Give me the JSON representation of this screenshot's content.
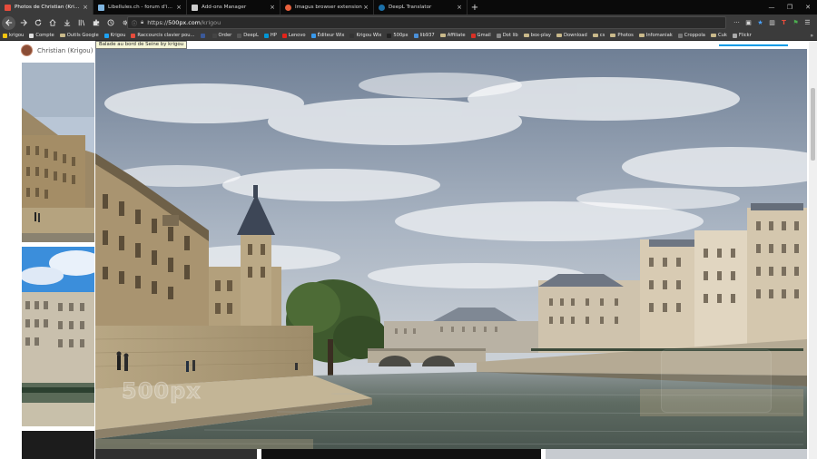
{
  "tabs": [
    {
      "title": "Photos de Christian (Krigou) S",
      "color": "#e74c3c",
      "active": true
    },
    {
      "title": "Libellules.ch - forum d'informa",
      "color": "#7fb5e0",
      "active": false
    },
    {
      "title": "Add-ons Manager",
      "color": "#cccccc",
      "active": false
    },
    {
      "title": "Imagus browser extension",
      "color": "#e8603c",
      "active": false
    },
    {
      "title": "DeepL Translator",
      "color": "#1b6fa8",
      "active": false
    }
  ],
  "urlbar": {
    "prefix": "https://",
    "host": "500px.com",
    "path": "/krigou"
  },
  "bookmarks": [
    {
      "label": "krigou",
      "color": "#f1c40f",
      "folder": false
    },
    {
      "label": "Compte",
      "color": "#e0e0e0",
      "folder": false
    },
    {
      "label": "Outils Google",
      "color": "#c9b98a",
      "folder": true
    },
    {
      "label": "Krigou",
      "color": "#1da1f2",
      "folder": false
    },
    {
      "label": "Raccourcis clavier pou...",
      "color": "#e74c3c",
      "folder": false
    },
    {
      "label": "",
      "color": "#3b5998",
      "folder": false
    },
    {
      "label": "Order",
      "color": "#444444",
      "folder": false
    },
    {
      "label": "DeepL",
      "color": "#555555",
      "folder": false
    },
    {
      "label": "HP",
      "color": "#0096d6",
      "folder": false
    },
    {
      "label": "Lenovo",
      "color": "#e2231a",
      "folder": false
    },
    {
      "label": "Éditeur Wix",
      "color": "#3899ec",
      "folder": false
    },
    {
      "label": "Krigou Wix",
      "color": "#333333",
      "folder": false
    },
    {
      "label": "500px",
      "color": "#222222",
      "folder": false
    },
    {
      "label": "lib937",
      "color": "#4a90d9",
      "folder": false
    },
    {
      "label": "Affiliate",
      "color": "#c9b98a",
      "folder": true
    },
    {
      "label": "Gmail",
      "color": "#d93025",
      "folder": false
    },
    {
      "label": "Dot lib",
      "color": "#888888",
      "folder": false
    },
    {
      "label": "box-play",
      "color": "#c9b98a",
      "folder": true
    },
    {
      "label": "Download",
      "color": "#c9b98a",
      "folder": true
    },
    {
      "label": "cs",
      "color": "#c9b98a",
      "folder": true
    },
    {
      "label": "Photos",
      "color": "#c9b98a",
      "folder": true
    },
    {
      "label": "Infomaniak",
      "color": "#c9b98a",
      "folder": true
    },
    {
      "label": "Croppola",
      "color": "#777777",
      "folder": false
    },
    {
      "label": "Cuk",
      "color": "#c9b98a",
      "folder": true
    },
    {
      "label": "Flickr",
      "color": "#aaaaaa",
      "folder": false
    }
  ],
  "bookmarks_overflow": "»",
  "profile": {
    "name": "Christian (Krigou) S"
  },
  "photo": {
    "tooltip": "Balade au bord de Seine by krigou",
    "watermark": "500px"
  },
  "colors": {
    "accent": "#0099e5",
    "chrome_dark": "#3b3b3b",
    "tab_dark": "#0a0a0a"
  },
  "icons": {
    "back": "arrow-left",
    "forward": "arrow-right",
    "reload": "reload",
    "home": "home",
    "download": "download",
    "library": "library",
    "addons": "puzzle",
    "clock": "clock",
    "gear": "gear"
  }
}
